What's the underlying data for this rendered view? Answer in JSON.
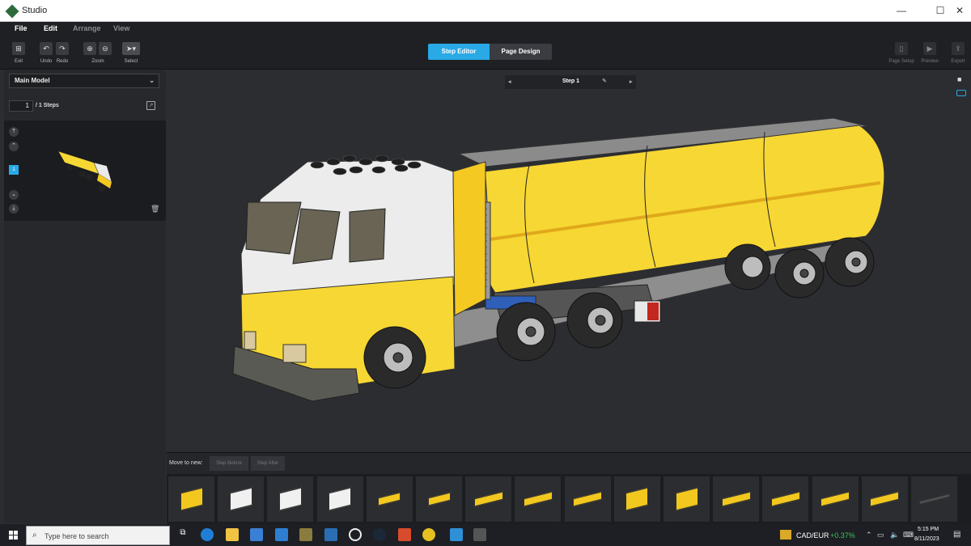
{
  "window": {
    "title": "Studio",
    "minimize": "—",
    "maximize": "☐",
    "close": "✕"
  },
  "menu": [
    "File",
    "Edit",
    "Arrange",
    "View"
  ],
  "toolbar": {
    "exit": "Exit",
    "undo": "Undo",
    "redo": "Redo",
    "zoom": "Zoom",
    "select": "Select",
    "page_setup": "Page Setup",
    "preview": "Preview",
    "export": "Export"
  },
  "modes": {
    "step_editor": "Step Editor",
    "page_design": "Page Design"
  },
  "left_panel": {
    "model": "Main Model",
    "current_step": "1",
    "steps_total": "/ 1 Steps",
    "step_badge": "1"
  },
  "viewport": {
    "step_label": "Step 1"
  },
  "move_bar": {
    "label": "Move to new:",
    "before": "Step Before",
    "after": "Step After"
  },
  "parts": [
    {
      "color": "#f2c81f",
      "icon": "slope-brick-icon"
    },
    {
      "color": "#f0f0f0",
      "icon": "slope-icon"
    },
    {
      "color": "#f0f0f0",
      "icon": "bracket-icon"
    },
    {
      "color": "#f0f0f0",
      "icon": "brick-icon"
    },
    {
      "color": "#f2c81f",
      "icon": "plate-1x4-icon"
    },
    {
      "color": "#f2c81f",
      "icon": "plate-2x2-icon"
    },
    {
      "color": "#f2c81f",
      "icon": "plate-1x8-icon"
    },
    {
      "color": "#f2c81f",
      "icon": "angle-plate-icon"
    },
    {
      "color": "#f2c81f",
      "icon": "plate-2x4-icon"
    },
    {
      "color": "#f2c81f",
      "icon": "angle-bracket-icon"
    },
    {
      "color": "#f2c81f",
      "icon": "technic-brick-icon"
    },
    {
      "color": "#f2c81f",
      "icon": "plate-1x6-icon"
    },
    {
      "color": "#f2c81f",
      "icon": "plate-1x6b-icon"
    },
    {
      "color": "#f2c81f",
      "icon": "plate-1x4b-icon"
    },
    {
      "color": "#f2c81f",
      "icon": "offset-plate-icon"
    },
    {
      "color": "#555555",
      "icon": "bar-icon"
    }
  ],
  "taskbar": {
    "search_placeholder": "Type here to search",
    "ticker_symbol": "CAD/EUR",
    "ticker_change": "+0.37%",
    "time": "5:15 PM",
    "date": "8/11/2023"
  },
  "colors": {
    "accent": "#29a9e6",
    "tank_yellow": "#f7d733",
    "cab_white": "#ececec",
    "chassis_grey": "#8e8e8e",
    "tire_black": "#2a2a2a",
    "ticker_green": "#39c45c"
  }
}
